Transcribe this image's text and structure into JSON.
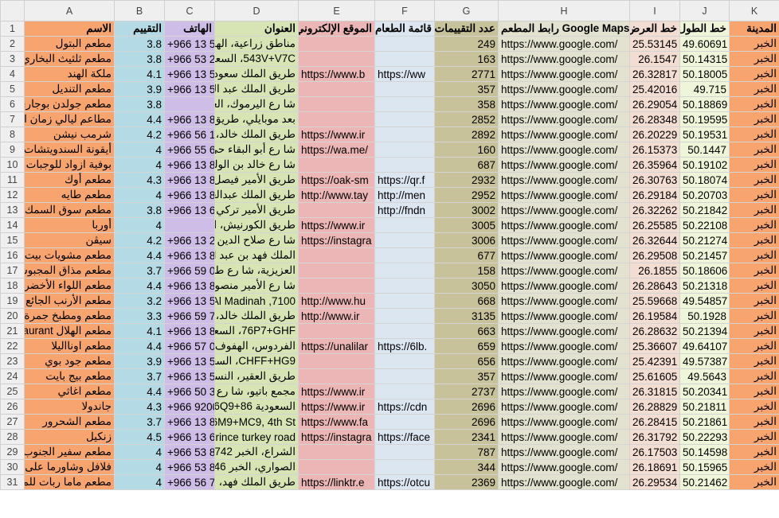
{
  "col_letters": [
    "A",
    "B",
    "C",
    "D",
    "E",
    "F",
    "G",
    "H",
    "I",
    "J",
    "K"
  ],
  "fills": [
    "#f8a46f",
    "#b4dbe5",
    "#cebde6",
    "#d7e5b5",
    "#edb6b6",
    "#dce6f1",
    "#c8c29a",
    "#e3e2d0",
    "#f3dcd2",
    "#eff5d9",
    "#f8a46f"
  ],
  "headers": [
    "الاسم",
    "التقييم",
    "الهاتف",
    "العنوان",
    "الموقع الإلكتروني",
    "قائمة الطعام",
    "عدد التقييمات",
    "رابط المطعم Google Maps",
    "خط العرض",
    "خط الطول",
    "المدينة"
  ],
  "rows": [
    [
      "مطعم البتول",
      "3.8",
      "+966 13 53",
      "مناطق زراعية، الهفوف",
      "",
      "",
      "249",
      "https://www.google.com/",
      "25.53145",
      "49.60691",
      "الخبر"
    ],
    [
      "مطعم ثلثيث البخاري الشرقية",
      "3.8",
      "+966 53 20",
      "543V+V7C، السعودية",
      "",
      "",
      "163",
      "https://www.google.com/",
      "26.1547",
      "50.14315",
      "الخبر"
    ],
    [
      "ملكة الهند",
      "4.1",
      "+966 13 53 26",
      "طريق الملك سعود، الخبر",
      "https://www.b",
      "https://ww",
      "2771",
      "https://www.google.com/",
      "26.32817",
      "50.18005",
      "الخبر"
    ],
    [
      "مطعم التنديل",
      "3.9",
      "+966 13 55",
      "طريق الملك عبد العزيز",
      "",
      "",
      "357",
      "https://www.google.com/",
      "25.42016",
      "49.715",
      "الخبر"
    ],
    [
      "مطعم جولدن بوجاري",
      "3.8",
      "",
      "شا رع اليرموك، العقربية",
      "",
      "",
      "358",
      "https://www.google.com/",
      "26.29054",
      "50.18869",
      "الخبر"
    ],
    [
      "مطاعم ليالي زمان الخبر",
      "4.4",
      "+966 13 89",
      "بعد موبايلي، طريق خالد",
      "",
      "",
      "2852",
      "https://www.google.com/",
      "26.28348",
      "50.19595",
      "الخبر"
    ],
    [
      "شرمب نيشن",
      "4.2",
      "+966 56 11",
      "طريق الملك خالد، الخبر",
      "https://www.ir",
      "",
      "2892",
      "https://www.google.com/",
      "26.20229",
      "50.19531",
      "الخبر"
    ],
    [
      "أيقونة السندويتشات",
      "4",
      "+966 55 66",
      "شا رع أبو البقاء حي الخبر",
      "https://wa.me/",
      "",
      "160",
      "https://www.google.com/",
      "26.15373",
      "50.1447",
      "الخبر"
    ],
    [
      "بوفية ازواد للوجبات الشعبية",
      "4",
      "+966 13 85",
      "شا رع خالد بن الوليد",
      "",
      "",
      "687",
      "https://www.google.com/",
      "26.35964",
      "50.19102",
      "الخبر"
    ],
    [
      "مطعم أوك",
      "4.3",
      "+966 13 80",
      "طريق الأمير فيصل بن فهد",
      "https://oak-sm",
      "https://qr.f",
      "2932",
      "https://www.google.com/",
      "26.30763",
      "50.18074",
      "الخبر"
    ],
    [
      "مطعم طايه",
      "4",
      "+966 13 89",
      "طريق الملك عبدالعزيز",
      "http://www.tay",
      "http://men",
      "2952",
      "https://www.google.com/",
      "26.29184",
      "50.20703",
      "الخبر"
    ],
    [
      "مطعم سوق السمك",
      "3.8",
      "+966 13 65",
      "طريق الأمير تركي، حي",
      "",
      "http://fndn",
      "3002",
      "https://www.google.com/",
      "26.32262",
      "50.21842",
      "الخبر"
    ],
    [
      "أوربا",
      "4",
      "",
      "طريق الكورنيش، السيف",
      "https://www.ir",
      "",
      "3005",
      "https://www.google.com/",
      "26.25585",
      "50.22108",
      "الخبر"
    ],
    [
      "سيڤن",
      "4.2",
      "+966 13 24",
      "شا رع صلاح الدين الأيوبي",
      "https://instagra",
      "",
      "3006",
      "https://www.google.com/",
      "26.32644",
      "50.21274",
      "الخبر"
    ],
    [
      "مطعم مشويات بيت الشام",
      "4.4",
      "+966 13 86",
      "الملك فهد بن عبد العزيز",
      "",
      "",
      "677",
      "https://www.google.com/",
      "26.29508",
      "50.21457",
      "الخبر"
    ],
    [
      "مطعم مذاق المجبوس المميز",
      "3.7",
      "+966 59 00",
      "العزيزية، شا رع طريق",
      "",
      "",
      "158",
      "https://www.google.com/",
      "26.1855",
      "50.18606",
      "الخبر"
    ],
    [
      "مطعم اللواء الأخضر للأكلات",
      "4.4",
      "+966 13 89",
      "شا رع الأمير منصور، الخبر",
      "",
      "",
      "3050",
      "https://www.google.com/",
      "26.28643",
      "50.21318",
      "الخبر"
    ],
    [
      "مطعم الأرنب الجائع",
      "3.2",
      "+966 13 55",
      "7100, Al Madinah",
      "http://www.hu",
      "",
      "668",
      "https://www.google.com/",
      "25.59668",
      "49.54857",
      "الخبر"
    ],
    [
      "مطعم ومطبخ جمرة الخبر",
      "3.3",
      "+966 59 74",
      "طريق الملك خالد، الخبر",
      "http://www.ir",
      "",
      "3135",
      "https://www.google.com/",
      "26.19584",
      "50.1928",
      "الخبر"
    ],
    [
      "مطعم الهلال Restaurant",
      "4.1",
      "+966 13 85",
      "76P7+GHF، السعودية",
      "",
      "",
      "663",
      "https://www.google.com/",
      "26.28632",
      "50.21394",
      "الخبر"
    ],
    [
      "مطعم اونااليلا",
      "4.4",
      "+966 57 03",
      "الفردوس، الهفوف",
      "https://unalilar",
      "https://6lb.",
      "659",
      "https://www.google.com/",
      "25.36607",
      "49.64107",
      "الخبر"
    ],
    [
      "مطعم جود بوي",
      "3.9",
      "+966 13 53",
      "CHFF+HG9، السعودية",
      "",
      "",
      "656",
      "https://www.google.com/",
      "25.42391",
      "49.57387",
      "الخبر"
    ],
    [
      "مطعم بيج بايت",
      "3.7",
      "+966 13 53",
      "طريق العقير، النسيم",
      "",
      "",
      "357",
      "https://www.google.com/",
      "25.61605",
      "49.5643",
      "الخبر"
    ],
    [
      "مطعم اغاثي",
      "4.4",
      "+966 50 35",
      "مجمع باتيو، شا رع الأمير",
      "https://www.ir",
      "",
      "2737",
      "https://www.google.com/",
      "26.31815",
      "50.20341",
      "الخبر"
    ],
    [
      "جاندولا",
      "4.3",
      "+966 9200",
      "السعودية 76Q9+86",
      "https://www.ir",
      "https://cdn",
      "2696",
      "https://www.google.com/",
      "26.28829",
      "50.21811",
      "الخبر"
    ],
    [
      "مطعم الشحرور",
      "3.7",
      "+966 13 85",
      "76M9+MC9, 4th St",
      "https://www.fa",
      "",
      "2696",
      "https://www.google.com/",
      "26.28415",
      "50.21861",
      "الخبر"
    ],
    [
      "زنكيل",
      "4.5",
      "+966 13 66",
      "Prince turkey road",
      "https://instagra",
      "https://face",
      "2341",
      "https://www.google.com/",
      "26.31792",
      "50.22293",
      "الخبر"
    ],
    [
      "مطعم سفير الجنوب للمندي",
      "4",
      "+966 53 83",
      "الشراع، الخبر 34742",
      "",
      "",
      "787",
      "https://www.google.com/",
      "26.17503",
      "50.14598",
      "الخبر"
    ],
    [
      "فلافل وشاورما على كيفك",
      "4",
      "+966 53 80",
      "الصواري، الخبر 34746",
      "",
      "",
      "344",
      "https://www.google.com/",
      "26.18691",
      "50.15965",
      "الخبر"
    ],
    [
      "مطعم ماما ربات للمأكولات",
      "4",
      "+966 56 70",
      "طريق الملك فهد، حي",
      "https://linktr.e",
      "https://otcu",
      "2369",
      "https://www.google.com/",
      "26.29534",
      "50.21462",
      "الخبر"
    ]
  ]
}
